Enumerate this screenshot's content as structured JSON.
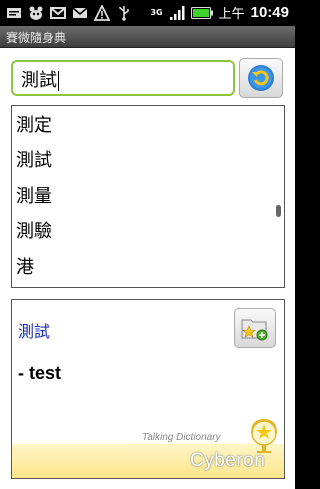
{
  "status_bar": {
    "ampm": "上午",
    "time": "10:49",
    "network": "3G",
    "icons": [
      "message-icon",
      "panda-icon",
      "gmail-icon",
      "email-icon",
      "alert-icon",
      "usb-icon",
      "3g-icon",
      "signal-icon",
      "battery-icon"
    ]
  },
  "title_bar": {
    "title": "賽微隨身典"
  },
  "search": {
    "value": "測試"
  },
  "suggestions": [
    "測定",
    "測試",
    "測量",
    "測驗",
    "港"
  ],
  "definition": {
    "word": "測試",
    "meaning": "- test"
  },
  "branding": {
    "tagline": "Talking Dictionary",
    "logo": "Cyberon"
  },
  "colors": {
    "search_border": "#8cc63f",
    "definition_word": "#1a2dbd",
    "brand_strip": "#fbe58a"
  }
}
